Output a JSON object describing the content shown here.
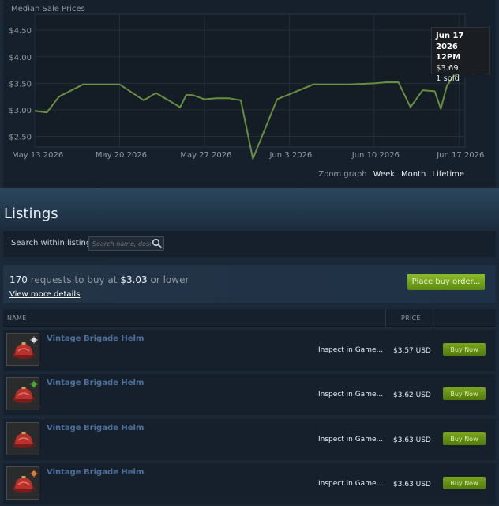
{
  "chart_data": {
    "type": "line",
    "title": "Median Sale Prices",
    "xlabel": "",
    "ylabel": "",
    "x_ticks": [
      "May 13 2026",
      "May 20 2026",
      "May 27 2026",
      "Jun 3 2026",
      "Jun 10 2026",
      "Jun 17 2026"
    ],
    "y_ticks": [
      "$2.50",
      "$3.00",
      "$3.50",
      "$4.00",
      "$4.50"
    ],
    "ylim": [
      2.3,
      4.8
    ],
    "xlim": [
      "2026-05-13",
      "2026-06-17"
    ],
    "grid": true,
    "line_color": "#688f3e",
    "series": [
      {
        "x": [
          "2026-05-13",
          "2026-05-14",
          "2026-05-15",
          "2026-05-17",
          "2026-05-20",
          "2026-05-22",
          "2026-05-23",
          "2026-05-25",
          "2026-05-25T12",
          "2026-05-26",
          "2026-05-27",
          "2026-05-28",
          "2026-05-29",
          "2026-05-30",
          "2026-05-31",
          "2026-06-02",
          "2026-06-05",
          "2026-06-08",
          "2026-06-10",
          "2026-06-11",
          "2026-06-12",
          "2026-06-13",
          "2026-06-14",
          "2026-06-15",
          "2026-06-15T12",
          "2026-06-16",
          "2026-06-16T12",
          "2026-06-17"
        ],
        "y": [
          2.98,
          2.95,
          3.25,
          3.48,
          3.48,
          3.18,
          3.32,
          3.05,
          3.28,
          3.28,
          3.2,
          3.22,
          3.22,
          3.18,
          2.08,
          3.2,
          3.48,
          3.48,
          3.5,
          3.52,
          3.52,
          3.05,
          3.37,
          3.35,
          3.02,
          3.45,
          3.62,
          3.69
        ]
      }
    ],
    "tooltip": {
      "date": "Jun 17 2026",
      "time": "12PM",
      "price": "$3.69",
      "sold": "1 sold"
    }
  },
  "zoom": {
    "label": "Zoom graph",
    "options": [
      "Week",
      "Month",
      "Lifetime"
    ]
  },
  "listings": {
    "title": "Listings",
    "search_label": "Search within listings:",
    "search_placeholder": "Search name, description",
    "buy_requests_count": "170",
    "buy_requests_text": "requests to buy at",
    "buy_requests_price": "$3.03",
    "buy_requests_suffix": "or lower",
    "view_more": "View more details",
    "place_order": "Place buy order...",
    "col_name": "NAME",
    "col_price": "PRICE",
    "rows": [
      {
        "name": "Vintage Brigade Helm",
        "inspect": "Inspect in Game...",
        "price": "$3.57 USD",
        "buy": "Buy Now",
        "paint": "#dcdcdc"
      },
      {
        "name": "Vintage Brigade Helm",
        "inspect": "Inspect in Game...",
        "price": "$3.62 USD",
        "buy": "Buy Now",
        "paint": "#4ca830"
      },
      {
        "name": "Vintage Brigade Helm",
        "inspect": "Inspect in Game...",
        "price": "$3.63 USD",
        "buy": "Buy Now",
        "paint": ""
      },
      {
        "name": "Vintage Brigade Helm",
        "inspect": "Inspect in Game...",
        "price": "$3.63 USD",
        "buy": "Buy Now",
        "paint": "#e07a2a"
      }
    ]
  }
}
